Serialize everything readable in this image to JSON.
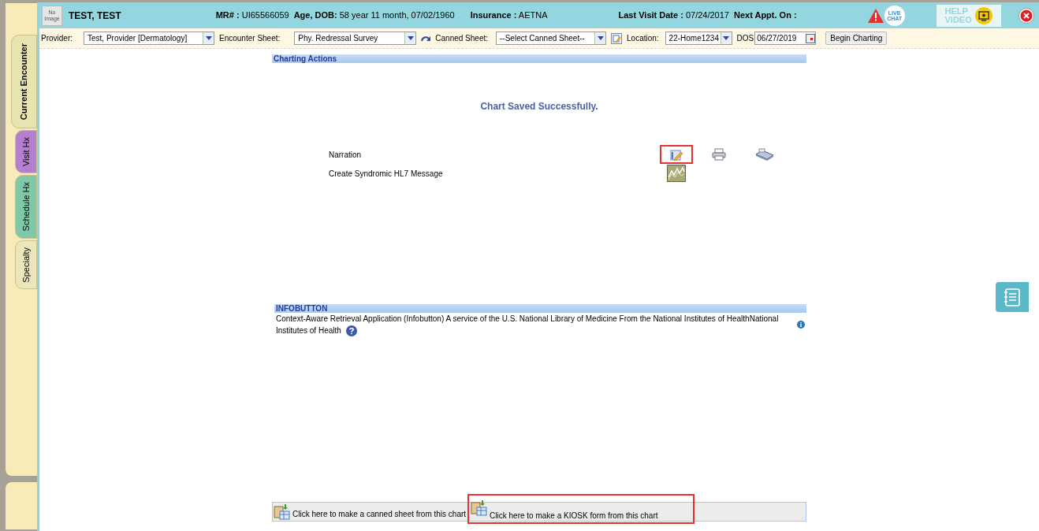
{
  "side_tabs": [
    {
      "label": "Current Encounter",
      "selected": true,
      "color": "#e8e4b0"
    },
    {
      "label": "Visit Hx",
      "selected": false,
      "color": "#b57fd0"
    },
    {
      "label": "Schedule Hx",
      "selected": false,
      "color": "#7fc8a8"
    },
    {
      "label": "Specialty",
      "selected": false,
      "color": "#ece7bb"
    }
  ],
  "header": {
    "photo_label": "No Image",
    "patient_name": "TEST, TEST",
    "fields": [
      {
        "label": "MR# :",
        "value": "UI65566059"
      },
      {
        "label": "Age, DOB:",
        "value": "58 year 11 month, 07/02/1960"
      },
      {
        "label": "Insurance :",
        "value": "AETNA"
      },
      {
        "label": "Last Visit Date :",
        "value": "07/24/2017"
      },
      {
        "label": "Next Appt. On :"
      }
    ],
    "live_chat": "LIVE CHAT",
    "help_video": [
      "HELP",
      "VIDEO"
    ]
  },
  "toolbar": {
    "provider": {
      "label": "Provider:",
      "value": "Test, Provider [Dermatology]"
    },
    "encounter_sheet": {
      "label": "Encounter Sheet:",
      "value": "Phy. Redressal Survey"
    },
    "canned_sheet": {
      "label": "Canned Sheet:",
      "value": "--Select Canned Sheet--"
    },
    "location": {
      "label": "Location:",
      "value": "22-Home1234"
    },
    "dos": {
      "label": "DOS",
      "value": "06/27/2019"
    },
    "begin_button": "Begin Charting"
  },
  "charting_actions": {
    "title": "Charting Actions",
    "message": "Chart Saved Successfully.",
    "rows": [
      {
        "label": "Narration",
        "kind": "narration",
        "highlighted": true
      },
      {
        "label": "Create Syndromic HL7 Message",
        "kind": "hl7",
        "highlighted": false
      }
    ]
  },
  "infobutton": {
    "title": "INFOBUTTON",
    "text_lines": [
      "Context-Aware Retrieval Application (Infobutton) A service of the U.S. National Library of Medicine From the National Institutes of HealthNational",
      "Institutes of Health"
    ]
  },
  "bottom_actions": [
    {
      "label": "Click here to make a canned sheet from this chart",
      "highlighted": false
    },
    {
      "label": "Click here to make a KIOSK form from this chart",
      "highlighted": true
    }
  ]
}
